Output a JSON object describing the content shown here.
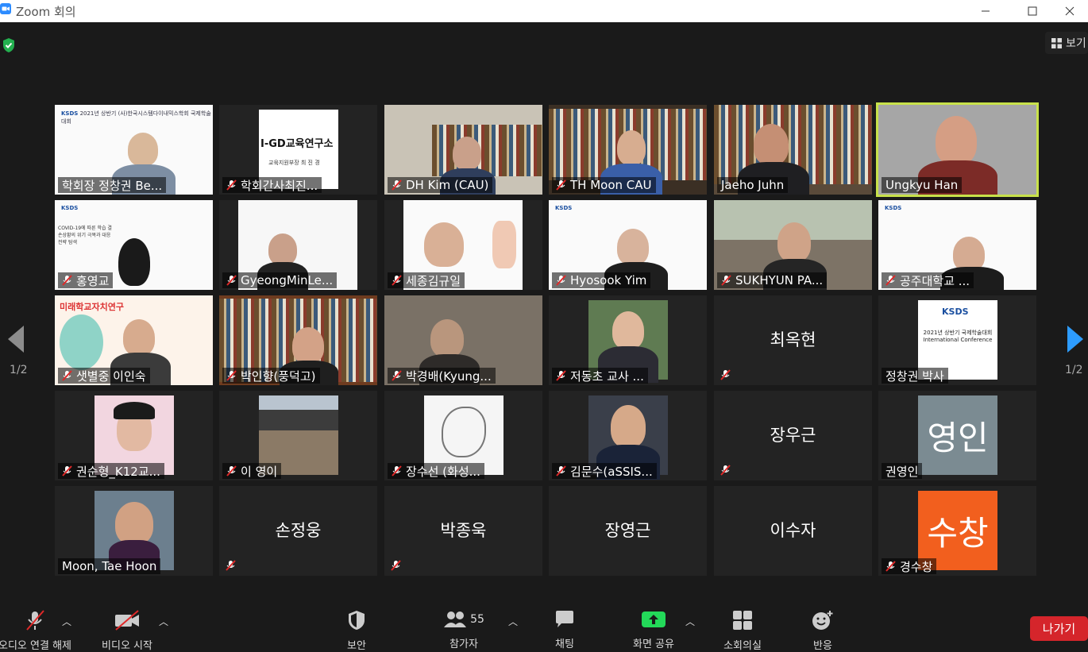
{
  "window": {
    "title": "Zoom 회의"
  },
  "top": {
    "view_label": "보기"
  },
  "pagination": {
    "left": "1/2",
    "right": "1/2"
  },
  "tiles": [
    {
      "name": "학회장 정창권 Be..."
    },
    {
      "name": "학회간사최진..."
    },
    {
      "name": "DH Kim (CAU)"
    },
    {
      "name": "TH Moon CAU"
    },
    {
      "name": "Jaeho Juhn"
    },
    {
      "name": "Ungkyu Han"
    },
    {
      "name": "홍영교"
    },
    {
      "name": "GyeongMinLe..."
    },
    {
      "name": "세종김규일"
    },
    {
      "name": "Hyosook Yim"
    },
    {
      "name": "SUKHYUN PA..."
    },
    {
      "name": "공주대학교 ..."
    },
    {
      "name": "샛별중 이인숙"
    },
    {
      "name": "박인향(풍덕고)"
    },
    {
      "name": "박경배(Kyung..."
    },
    {
      "name": "저동초 교사 ..."
    },
    {
      "center": "최옥현"
    },
    {
      "name": "정창권 박사"
    },
    {
      "name": "권순형_K12교..."
    },
    {
      "name": "이 영이"
    },
    {
      "name": "장수선 (화성..."
    },
    {
      "name": "김문수(aSSIS..."
    },
    {
      "center": "장우근"
    },
    {
      "name": "권영인",
      "avatar": "영인"
    },
    {
      "name": "Moon, Tae Hoon"
    },
    {
      "center": "손정웅"
    },
    {
      "center": "박종욱"
    },
    {
      "center": "장영근"
    },
    {
      "center": "이수자"
    },
    {
      "name": "경수창",
      "avatar": "수창"
    }
  ],
  "slides": {
    "ksds": "KSDS",
    "ksds_line": "2021년 상반기 (사)한국시스템다이내믹스학회 국제학술대회",
    "conf_year": "2021년 상반기 국제학술대회",
    "conf_en": "International Conference",
    "igd": "I-GD교육연구소",
    "igd_sub": "교육지원부장 최 진 경",
    "covid": "COVID-19에 따른 학습 결손상황의 위기 극복과 대응전략 탐색",
    "school": "미래학교자치연구"
  },
  "toolbar": {
    "participants_count": "55",
    "mute": "오디오 연결 해제",
    "video": "비디오 시작",
    "security": "보안",
    "participants": "참가자",
    "chat": "채팅",
    "share": "화면 공유",
    "record": "소회의실",
    "reactions": "반응",
    "leave": "나가기"
  },
  "colors": {
    "active_speaker": "#c8e14a",
    "leave": "#d5252b",
    "share": "#23d959",
    "avatar_gray": "#7b8b92",
    "avatar_orange": "#f25f1e"
  }
}
